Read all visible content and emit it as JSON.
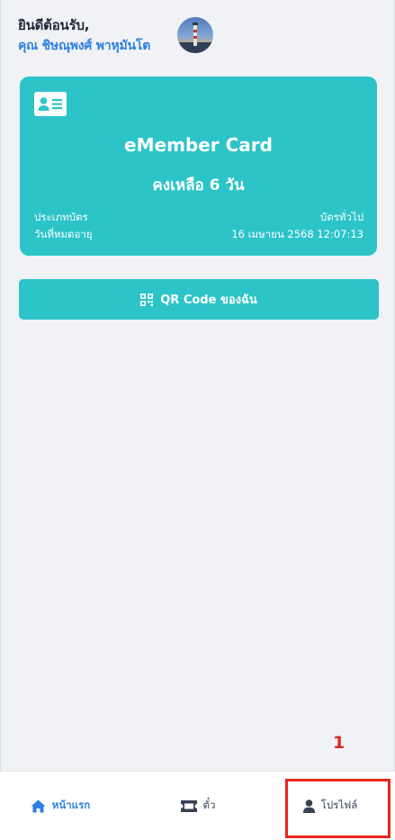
{
  "header": {
    "welcome": "ยินดีต้อนรับ,",
    "username": "คุณ ชิษณุพงศ์ พาหุมันโต"
  },
  "card": {
    "icon": "id-card-icon",
    "title": "eMember Card",
    "remaining": "คงเหลือ 6 วัน",
    "type_label": "ประเภทบัตร",
    "type_value": "บัตรทั่วไป",
    "expiry_label": "วันที่หมดอายุ",
    "expiry_value": "16 เมษายน 2568 12:07:13"
  },
  "qr_button": {
    "icon": "qr-code-icon",
    "label": "QR Code ของฉัน"
  },
  "annotation": {
    "number": "1"
  },
  "nav": {
    "home": "หน้าแรก",
    "ticket": "ตั๋ว",
    "profile": "โปรไฟล์"
  },
  "colors": {
    "accent": "#2cc4c8",
    "link": "#2f7fe0",
    "background": "#f0f2f6",
    "annotation": "#e8261c"
  }
}
